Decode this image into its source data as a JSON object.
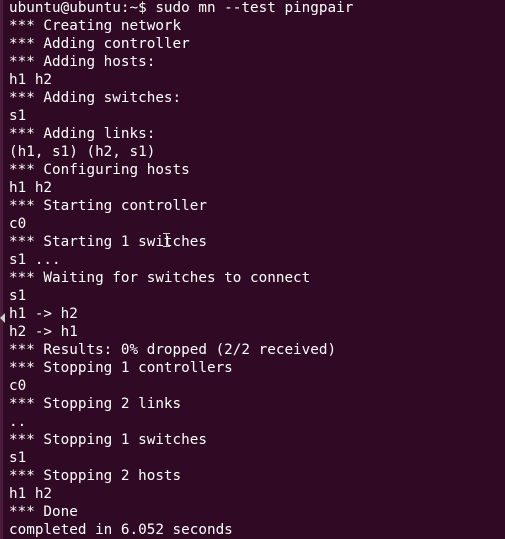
{
  "terminal": {
    "background": "#300a24",
    "foreground": "#ffffff",
    "lines": [
      "ubuntu@ubuntu:~$ sudo mn --test pingpair",
      "*** Creating network",
      "*** Adding controller",
      "*** Adding hosts:",
      "h1 h2",
      "*** Adding switches:",
      "s1",
      "*** Adding links:",
      "(h1, s1) (h2, s1)",
      "*** Configuring hosts",
      "h1 h2",
      "*** Starting controller",
      "c0",
      "*** Starting 1 switches",
      "s1 ...",
      "*** Waiting for switches to connect",
      "s1",
      "h1 -> h2",
      "h2 -> h1",
      "*** Results: 0% dropped (2/2 received)",
      "*** Stopping 1 controllers",
      "c0",
      "*** Stopping 2 links",
      "..",
      "*** Stopping 1 switches",
      "s1",
      "*** Stopping 2 hosts",
      "h1 h2",
      "*** Done",
      "completed in 6.052 seconds"
    ]
  }
}
